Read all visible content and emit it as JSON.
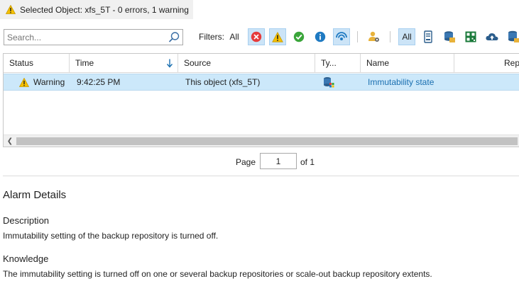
{
  "selected_bar": {
    "icon": "warning-icon",
    "prefix": "Selected Object:",
    "text": "xfs_5T  - 0 errors, 1 warning"
  },
  "toolbar": {
    "search_placeholder": "Search...",
    "filters_label": "Filters:",
    "filter_all_severity": "All",
    "filter_all_type": "All",
    "severity_filters": [
      "error-filter-icon",
      "warning-filter-icon",
      "success-filter-icon",
      "info-filter-icon",
      "resolved-filter-icon"
    ],
    "type_filters": [
      "user-settings-icon",
      "server-icon",
      "repository-icon",
      "qr-object-icon",
      "cloud-icon",
      "database-icon"
    ]
  },
  "grid": {
    "columns": {
      "status": "Status",
      "time": "Time",
      "source": "Source",
      "type": "Ty...",
      "name": "Name",
      "repeat": "Rep"
    },
    "rows": [
      {
        "status": "Warning",
        "time": "9:42:25 PM",
        "source": "This object (xfs_5T)",
        "type_icon": "repository-type-icon",
        "name": "Immutability state"
      }
    ]
  },
  "pager": {
    "page_label": "Page",
    "page_value": "1",
    "of_label": "of 1"
  },
  "details": {
    "title": "Alarm Details",
    "description_title": "Description",
    "description_body": "Immutability setting of the backup repository is turned off.",
    "knowledge_title": "Knowledge",
    "knowledge_body": "The immutability setting is turned off on one or several backup repositories or scale-out backup repository extents."
  },
  "colors": {
    "selection": "#cce8fa",
    "link": "#1a6fb0",
    "error": "#e63b3b",
    "warning": "#f5c000",
    "success": "#3aa53a",
    "info": "#1f7ac2",
    "toggle_on": "#cce4f7"
  }
}
